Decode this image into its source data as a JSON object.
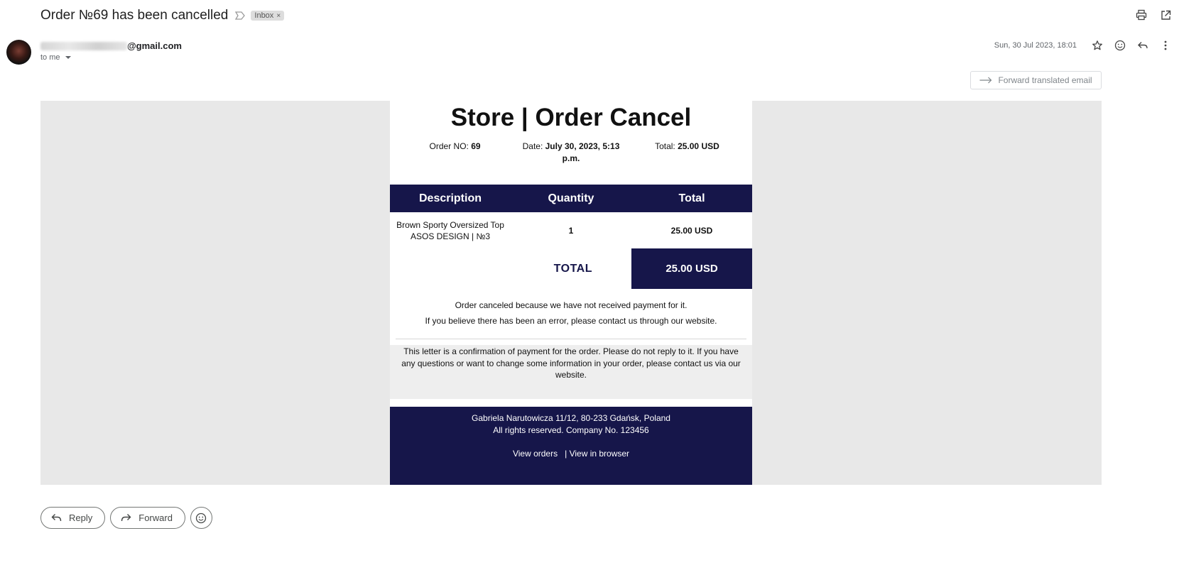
{
  "header": {
    "subject": "Order №69 has been cancelled",
    "label_chip": "Inbox",
    "chip_close": "×",
    "icons": [
      "print-icon",
      "open-in-new-window-icon"
    ]
  },
  "sender": {
    "email_suffix": "@gmail.com",
    "to_me": "to me",
    "date": "Sun, 30 Jul 2023, 18:01",
    "icons": [
      "star-icon",
      "emoji-icon",
      "reply-icon",
      "more-vert-icon"
    ]
  },
  "forward_translated": "Forward translated email",
  "email": {
    "title": "Store | Order Cancel",
    "order_no_label": "Order NO: ",
    "order_no": "69",
    "date_label": "Date: ",
    "date_value": "July 30, 2023, 5:13 p.m.",
    "total_label": "Total: ",
    "total_value": "25.00 USD",
    "table": {
      "headers": [
        "Description",
        "Quantity",
        "Total"
      ],
      "rows": [
        {
          "description": "Brown Sporty Oversized Top ASOS DESIGN | №3",
          "quantity": "1",
          "total": "25.00 USD"
        }
      ]
    },
    "grand_total_label": "TOTAL",
    "grand_total_value": "25.00 USD",
    "cancel_line1": "Order canceled because we have not received payment for it.",
    "cancel_line2": "If you believe there has been an error, please contact us through our website.",
    "confirmation": "This letter is a confirmation of payment for the order. Please do not reply to it. If you have any questions or want to change some information in your order, please contact us via our website.",
    "footer_address": "Gabriela Narutowicza 11/12, 80-233 Gdańsk, Poland",
    "footer_rights": "All rights reserved.  Company No. 123456",
    "footer_link_orders": "View orders",
    "footer_link_sep": "| ",
    "footer_link_browser": "View in browser"
  },
  "actions": {
    "reply": "Reply",
    "forward": "Forward"
  },
  "colors": {
    "navy": "#16164a",
    "background_gray": "#e8e8e8"
  }
}
